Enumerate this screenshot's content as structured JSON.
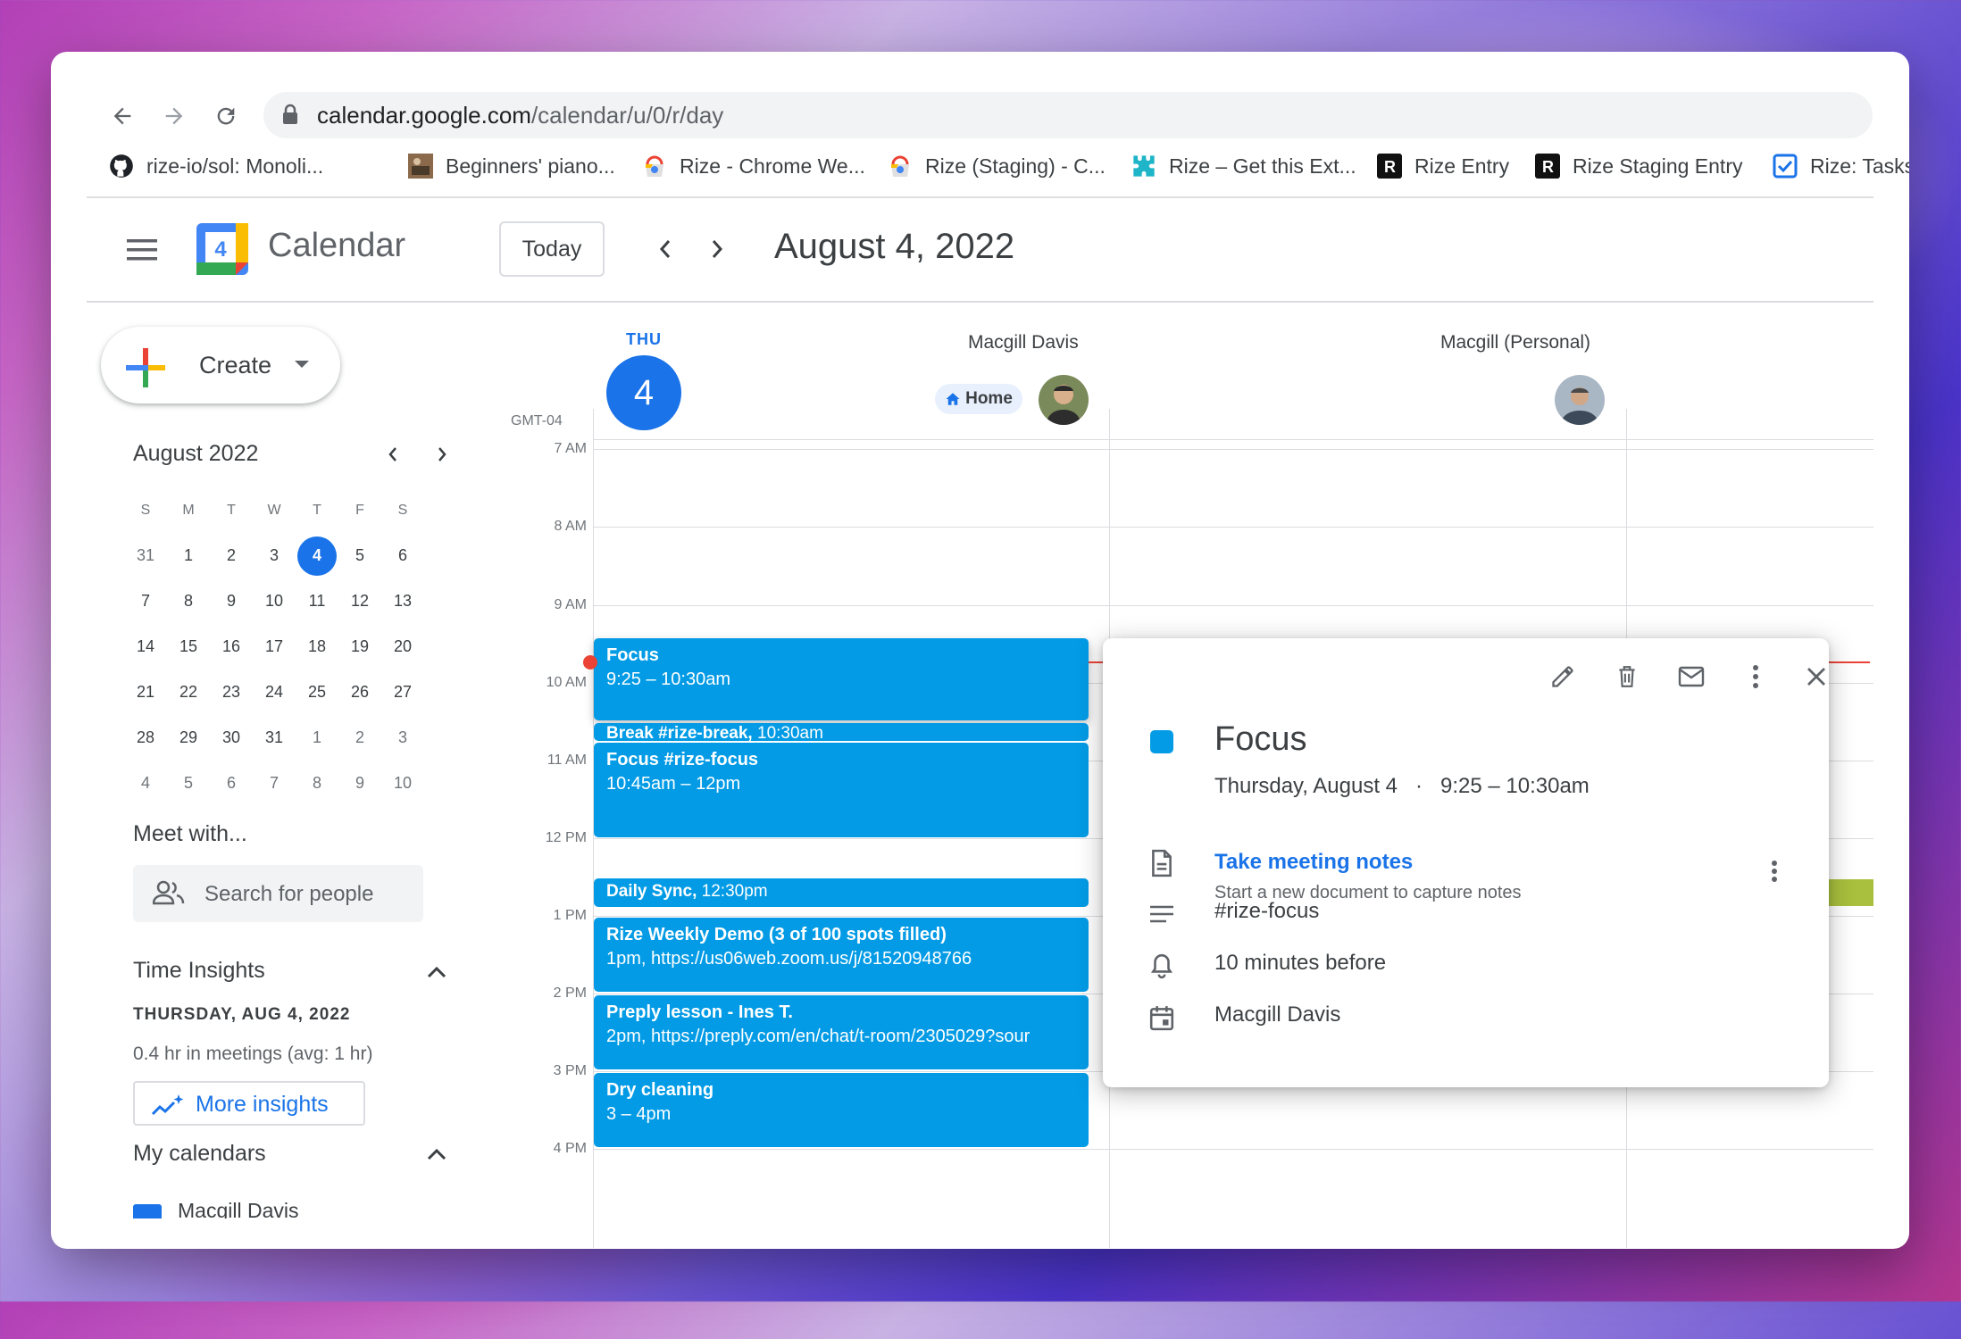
{
  "browser": {
    "url_host": "calendar.google.com",
    "url_path": "/calendar/u/0/r/day",
    "bookmarks": [
      {
        "label": "rize-io/sol: Monoli...",
        "icon": "github-icon"
      },
      {
        "label": "Beginners' piano...",
        "icon": "image-thumbnail-icon"
      },
      {
        "label": "Rize - Chrome We...",
        "icon": "chrome-webstore-icon"
      },
      {
        "label": "Rize (Staging) - C...",
        "icon": "chrome-webstore-icon"
      },
      {
        "label": "Rize – Get this Ext...",
        "icon": "puzzle-icon"
      },
      {
        "label": "Rize Entry",
        "icon": "r-logo-icon"
      },
      {
        "label": "Rize Staging Entry",
        "icon": "r-logo-icon"
      },
      {
        "label": "Rize: Tasks -",
        "icon": "checkbox-icon"
      }
    ]
  },
  "header": {
    "app_title": "Calendar",
    "logo_day": "4",
    "today_label": "Today",
    "date_title": "August 4, 2022"
  },
  "sidebar": {
    "create_label": "Create",
    "mini_cal": {
      "month": "August 2022",
      "weekdays": [
        "S",
        "M",
        "T",
        "W",
        "T",
        "F",
        "S"
      ],
      "weeks": [
        [
          "31",
          "1",
          "2",
          "3",
          "4",
          "5",
          "6"
        ],
        [
          "7",
          "8",
          "9",
          "10",
          "11",
          "12",
          "13"
        ],
        [
          "14",
          "15",
          "16",
          "17",
          "18",
          "19",
          "20"
        ],
        [
          "21",
          "22",
          "23",
          "24",
          "25",
          "26",
          "27"
        ],
        [
          "28",
          "29",
          "30",
          "31",
          "1",
          "2",
          "3"
        ],
        [
          "4",
          "5",
          "6",
          "7",
          "8",
          "9",
          "10"
        ]
      ]
    },
    "meet_title": "Meet with...",
    "people_placeholder": "Search for people",
    "insights_title": "Time Insights",
    "insights_date": "THURSDAY, AUG 4, 2022",
    "insights_stats": "0.4 hr in meetings (avg: 1 hr)",
    "more_insights_label": "More insights",
    "my_calendars_title": "My calendars",
    "my_calendars_first": "Macgill Davis"
  },
  "grid": {
    "day_abbr": "THU",
    "day_num": "4",
    "col1_name": "Macgill Davis",
    "col1_chip": "Home",
    "col2_name": "Macgill (Personal)",
    "timezone": "GMT-04",
    "hours": [
      "7 AM",
      "8 AM",
      "9 AM",
      "10 AM",
      "11 AM",
      "12 PM",
      "1 PM",
      "2 PM",
      "3 PM",
      "4 PM"
    ]
  },
  "events": {
    "focus1": {
      "title": "Focus",
      "time": "9:25 – 10:30am"
    },
    "break": {
      "title": "Break #rize-break,",
      "time": " 10:30am"
    },
    "focus2": {
      "title": "Focus #rize-focus",
      "time": "10:45am – 12pm"
    },
    "sync": {
      "title": "Daily Sync,",
      "time": " 12:30pm"
    },
    "demo": {
      "title": "Rize Weekly Demo (3 of 100 spots filled)",
      "time": "1pm, https://us06web.zoom.us/j/81520948766"
    },
    "preply": {
      "title": "Preply lesson - Ines T.",
      "time": "2pm, https://preply.com/en/chat/t-room/2305029?sour"
    },
    "dry": {
      "title": "Dry cleaning",
      "time": "3 – 4pm"
    }
  },
  "popup": {
    "title": "Focus",
    "when": "Thursday, August 4   ·   9:25 – 10:30am",
    "notes_link": "Take meeting notes",
    "notes_sub": "Start a new document to capture notes",
    "description": "#rize-focus",
    "reminder": "10 minutes before",
    "calendar": "Macgill Davis"
  },
  "colors": {
    "event": "#039be5",
    "accent": "#1a73e8",
    "now_line": "#ea4335"
  }
}
